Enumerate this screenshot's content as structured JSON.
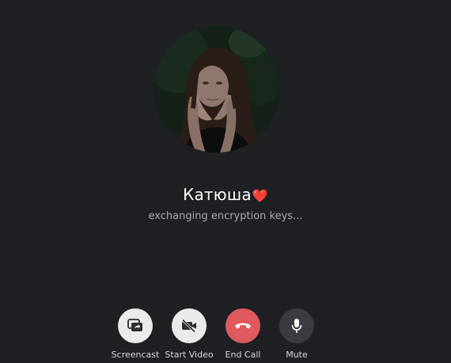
{
  "call": {
    "contact_name": "Катюша",
    "name_emoji": "❤️",
    "status": "exchanging encryption keys..."
  },
  "controls": {
    "screencast": {
      "label": "Screencast",
      "icon": "screencast-icon"
    },
    "start_video": {
      "label": "Start Video",
      "icon": "video-off-icon"
    },
    "end_call": {
      "label": "End Call",
      "icon": "phone-hangup-icon"
    },
    "mute": {
      "label": "Mute",
      "icon": "microphone-icon"
    }
  },
  "colors": {
    "background": "#1e2024",
    "end_call": "#de5a5f",
    "light_button": "#e9eaec",
    "dark_button": "#3a3c41",
    "status_text": "#a6abb2"
  }
}
